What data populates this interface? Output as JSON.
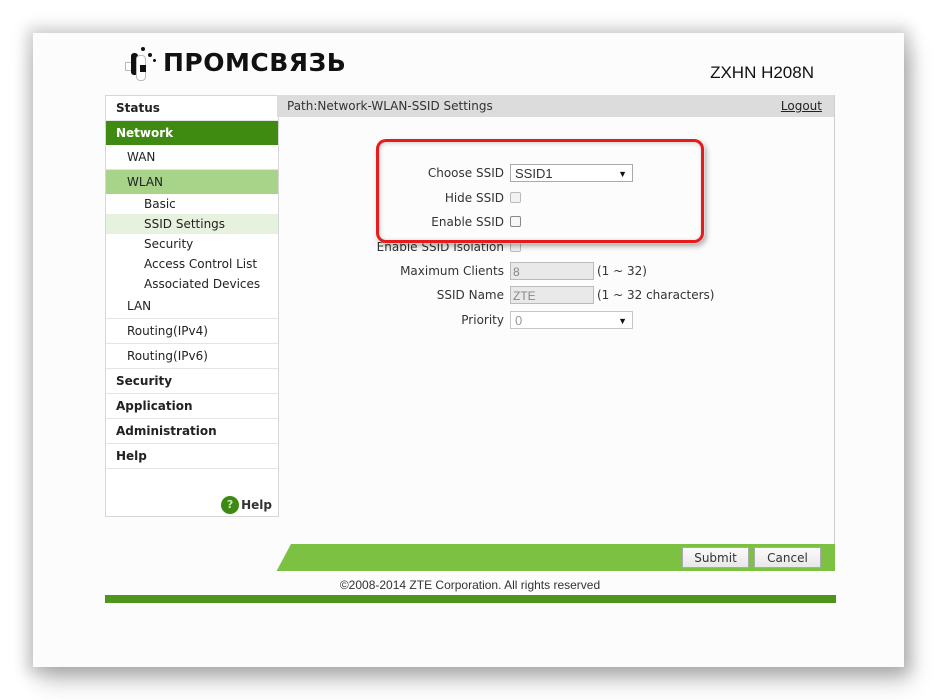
{
  "header": {
    "brand": "ПРОМСВЯЗЬ",
    "model": "ZXHN H208N"
  },
  "sidebar": {
    "items": [
      {
        "label": "Status",
        "level": 0
      },
      {
        "label": "Network",
        "level": 0,
        "active": true
      },
      {
        "label": "WAN",
        "level": 1
      },
      {
        "label": "WLAN",
        "level": 1,
        "active": true
      },
      {
        "label": "Basic",
        "level": 2
      },
      {
        "label": "SSID Settings",
        "level": 2,
        "active": true
      },
      {
        "label": "Security",
        "level": 2
      },
      {
        "label": "Access Control List",
        "level": 2
      },
      {
        "label": "Associated Devices",
        "level": 2
      },
      {
        "label": "LAN",
        "level": 1
      },
      {
        "label": "Routing(IPv4)",
        "level": 1
      },
      {
        "label": "Routing(IPv6)",
        "level": 1
      },
      {
        "label": "Security",
        "level": 0
      },
      {
        "label": "Application",
        "level": 0
      },
      {
        "label": "Administration",
        "level": 0
      },
      {
        "label": "Help",
        "level": 0
      }
    ],
    "help_label": "Help",
    "help_icon": "?"
  },
  "path": {
    "text": "Path:Network-WLAN-SSID Settings",
    "logout_label": "Logout"
  },
  "form": {
    "choose_ssid": {
      "label": "Choose SSID",
      "value": "SSID1"
    },
    "hide_ssid": {
      "label": "Hide SSID",
      "checked": false,
      "disabled": true
    },
    "enable_ssid": {
      "label": "Enable SSID",
      "checked": false
    },
    "enable_isolation": {
      "label": "Enable SSID Isolation",
      "checked": false,
      "disabled": true
    },
    "max_clients": {
      "label": "Maximum Clients",
      "value": "8",
      "hint": "(1 ~ 32)"
    },
    "ssid_name": {
      "label": "SSID Name",
      "value": "ZTE",
      "hint": "(1 ~ 32 characters)"
    },
    "priority": {
      "label": "Priority",
      "value": "0"
    }
  },
  "actions": {
    "submit_label": "Submit",
    "cancel_label": "Cancel"
  },
  "footer": {
    "copyright": "©2008-2014 ZTE Corporation. All rights reserved"
  },
  "colors": {
    "nav_active": "#3f8a10",
    "nav_sub_active": "#a8d48a",
    "action_bar": "#7cc142",
    "highlight": "#e81b1b"
  }
}
